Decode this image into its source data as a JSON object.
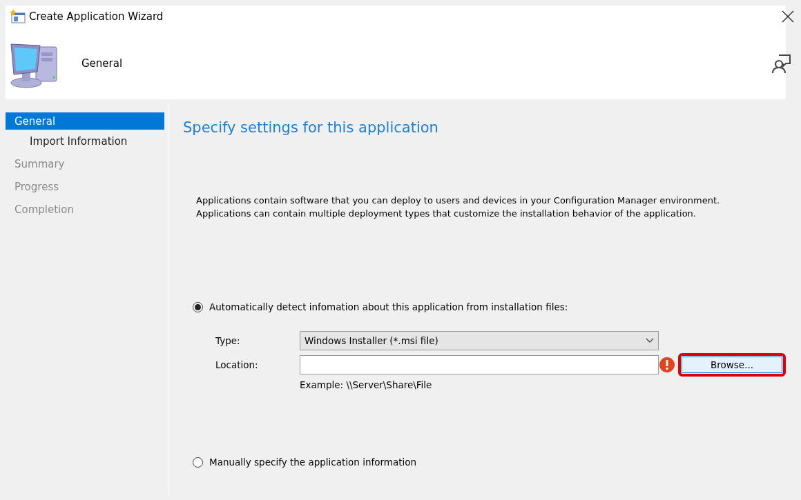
{
  "window": {
    "title": "Create Application Wizard"
  },
  "header": {
    "title": "General"
  },
  "sidebar": {
    "items": [
      {
        "label": "General",
        "selected": true,
        "disabled": false,
        "children": [
          {
            "label": "Import Information",
            "selected": false,
            "disabled": false
          }
        ]
      },
      {
        "label": "Summary",
        "selected": false,
        "disabled": true
      },
      {
        "label": "Progress",
        "selected": false,
        "disabled": true
      },
      {
        "label": "Completion",
        "selected": false,
        "disabled": true
      }
    ]
  },
  "content": {
    "heading": "Specify settings for this application",
    "description": "Applications contain software that you can deploy to users and devices in your Configuration Manager environment. Applications can contain multiple deployment types that customize the installation behavior of the application.",
    "options": [
      {
        "label": "Automatically detect infomation about this application from installation files:",
        "selected": true
      },
      {
        "label": "Manually specify the application information",
        "selected": false
      }
    ],
    "type_label": "Type:",
    "type_value": "Windows Installer (*.msi file)",
    "location_label": "Location:",
    "location_error": true,
    "browse": {
      "label": "Browse...",
      "highlighted": true
    },
    "example": "Example: \\\\Server\\Share\\File"
  }
}
